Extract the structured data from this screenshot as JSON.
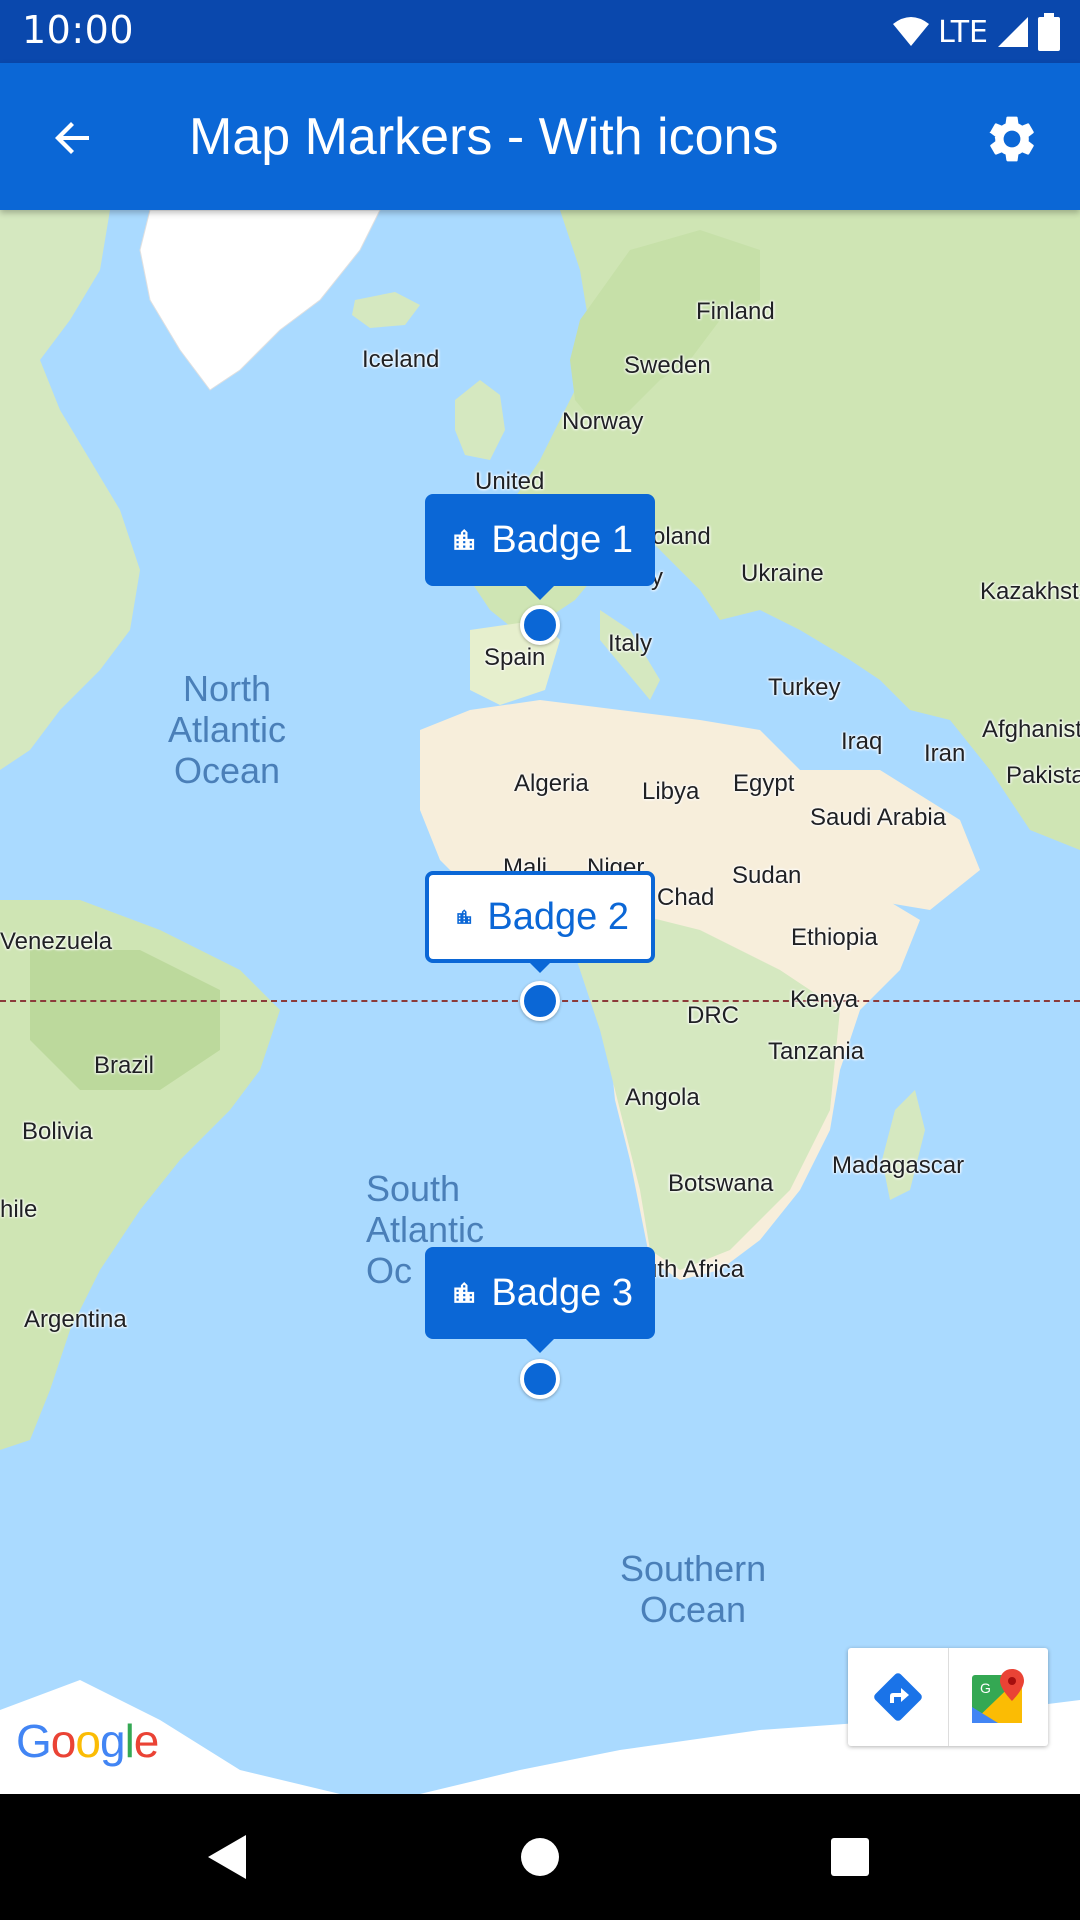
{
  "status_bar": {
    "time": "10:00",
    "network": "LTE",
    "icons": [
      "wifi-icon",
      "signal-icon",
      "battery-icon"
    ]
  },
  "app_bar": {
    "title": "Map Markers - With icons",
    "back_icon": "arrow-back-icon",
    "settings_icon": "gear-icon",
    "color": "#0b67d6"
  },
  "map": {
    "labels": {
      "iceland": "Iceland",
      "finland": "Finland",
      "sweden": "Sweden",
      "norway": "Norway",
      "united": "United",
      "poland": "oland",
      "ukraine": "Ukraine",
      "kazakhstan": "Kazakhsta",
      "italy": "Italy",
      "spain": "Spain",
      "turkey": "Turkey",
      "afghanistan": "Afghanist",
      "iraq": "Iraq",
      "iran": "Iran",
      "pakistan": "Pakista",
      "algeria": "Algeria",
      "libya": "Libya",
      "egypt": "Egypt",
      "saudi_arabia": "Saudi Arabia",
      "mali": "Mali",
      "niger": "Niger",
      "sudan": "Sudan",
      "chad": "Chad",
      "ethiopia": "Ethiopia",
      "venezuela": "Venezuela",
      "kenya": "Kenya",
      "drc": "DRC",
      "tanzania": "Tanzania",
      "brazil": "Brazil",
      "angola": "Angola",
      "bolivia": "Bolivia",
      "madagascar": "Madagascar",
      "botswana": "Botswana",
      "chile": "hile",
      "south_africa": "uth Africa",
      "argentina": "Argentina",
      "germany_fragment": "y"
    },
    "oceans": {
      "north_atlantic": "North\nAtlantic\nOcean",
      "south_atlantic": "South\nAtlantic\nOc",
      "southern": "Southern\nOcean"
    },
    "markers": [
      {
        "label": "Badge 1",
        "icon": "building-icon",
        "style": "filled"
      },
      {
        "label": "Badge 2",
        "icon": "building-icon",
        "style": "outlined"
      },
      {
        "label": "Badge 3",
        "icon": "building-icon",
        "style": "filled"
      }
    ],
    "toolbar": {
      "directions_icon": "directions-icon",
      "maps_icon": "google-maps-icon"
    },
    "logo": "Google"
  },
  "nav_bar": {
    "back_icon": "nav-back-icon",
    "home_icon": "nav-home-icon",
    "recents_icon": "nav-recents-icon"
  }
}
